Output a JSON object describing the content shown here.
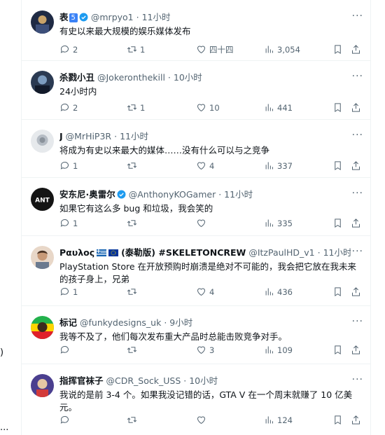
{
  "tweets": [
    {
      "name": "表",
      "badge": "5",
      "handle": "@mrpyo1",
      "time": "11小时",
      "text": "有史以来最大规模的娱乐媒体发布",
      "replies": "2",
      "retweets": "1",
      "likes": "四十四",
      "views": "3,054",
      "avatar": "dark-blue-avatar"
    },
    {
      "name": "杀戮小丑",
      "handle": "@Jokeronthekill",
      "time": "10小时",
      "text": "24小时内",
      "replies": "2",
      "retweets": "1",
      "likes": "10",
      "views": "441",
      "avatar": "joker-avatar"
    },
    {
      "name": "J",
      "handle": "@MrHiP3R",
      "time": "11小时",
      "text": "将成为有史以来最大的媒体……没有什么可以与之竞争",
      "replies": "1",
      "retweets": "",
      "likes": "4",
      "views": "337",
      "avatar": "grey-avatar"
    },
    {
      "name": "安东尼·奥雷尔",
      "handle": "@AnthonyKOGamer",
      "time": "11小时",
      "text": "如果它有这么多 bug 和垃圾，我会笑的",
      "replies": "1",
      "retweets": "",
      "likes": "",
      "views": "335",
      "avatar": "ant-avatar",
      "avatar_text": "ANT"
    },
    {
      "name": "Ραυλος",
      "name_suffix": "(泰勒版) #SKELETONCREW",
      "handle": "@ItzPaulHD_v1",
      "time": "11小时",
      "text": "PlayStation Store 在开放预购时崩溃是绝对不可能的，我会把它放在我未来的孩子身上，兄弟",
      "replies": "1",
      "retweets": "",
      "likes": "4",
      "views": "436",
      "avatar": "person-avatar"
    },
    {
      "name": "标记",
      "handle": "@funkydesigns_uk",
      "time": "9小时",
      "text": "我等不及了，他们每次发布重大产品时总能击败竞争对手。",
      "replies": "",
      "retweets": "",
      "likes": "3",
      "views": "109",
      "avatar": "rasta-avatar"
    },
    {
      "name": "指挥官袜子",
      "handle": "@CDR_Sock_USS",
      "time": "10小时",
      "text": "我说的是前 3-4 个。如果我没记错的话，GTA V 在一个周末就赚了 10 亿美元。",
      "replies": "",
      "retweets": "",
      "likes": "",
      "views": "124",
      "avatar": "sock-avatar"
    }
  ],
  "ui": {
    "separator": "·",
    "more": "···",
    "left_paren": ")",
    "left_ellipsis": "..."
  },
  "colors": {
    "verified": "#1d9bf0",
    "text": "#0f1419",
    "secondary": "#536471",
    "border": "#eff3f4"
  }
}
